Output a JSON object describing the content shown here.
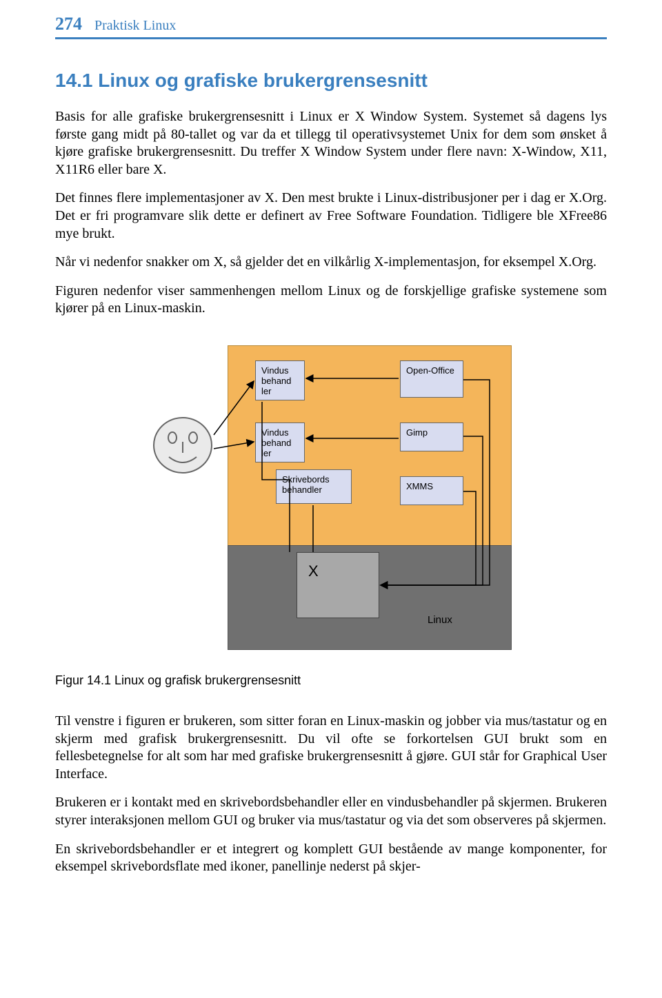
{
  "page": {
    "number": "274",
    "running_head": "Praktisk Linux"
  },
  "section": {
    "title": "14.1  Linux og grafiske brukergrensesnitt"
  },
  "paragraphs": {
    "p1": "Basis for alle grafiske brukergrensesnitt i Linux er X Window System. Systemet så dagens lys første gang midt på 80-tallet og var da et tillegg til operativsystemet Unix for dem som ønsket å kjøre grafiske brukergrensesnitt. Du treffer X Window System under flere navn: X-Window, X11, X11R6 eller bare X.",
    "p2": "Det finnes flere implementasjoner av X. Den mest brukte i Linux-distribusjoner per i dag er X.Org. Det er fri programvare slik dette er definert av Free Software Foundation. Tidligere ble XFree86 mye brukt.",
    "p3": "Når vi nedenfor snakker om X, så gjelder det en vilkårlig X-implementasjon, for eksempel X.Org.",
    "p4": "Figuren nedenfor viser sammenhengen mellom Linux og de forskjellige grafiske systemene som kjører på en Linux-maskin.",
    "p5": "Til venstre i figuren er brukeren, som sitter foran en Linux-maskin og jobber via mus/tastatur og en skjerm med grafisk brukergrensesnitt. Du vil ofte se forkortelsen GUI brukt som en fellesbetegnelse for alt som har med grafiske brukergrensesnitt å gjøre. GUI står for Graphical User Interface.",
    "p6": "Brukeren er i kontakt med en skrivebordsbehandler eller en vindusbehandler på skjermen. Brukeren styrer interaksjonen mellom GUI og bruker via mus/tastatur og via det som observeres på skjermen.",
    "p7": "En skrivebordsbehandler er et integrert og komplett GUI bestående av mange komponenter, for eksempel skrivebordsflate med ikoner, panellinje nederst på skjer-"
  },
  "diagram": {
    "wm1": "Vindus behand ler",
    "wm2": "Vindus behand ler",
    "desk": "Skrivebords behandler",
    "open": "Open-Office",
    "gimp": "Gimp",
    "xmms": "XMMS",
    "x": "X",
    "linux": "Linux"
  },
  "figure_caption": "Figur 14.1  Linux og grafisk brukergrensesnitt"
}
